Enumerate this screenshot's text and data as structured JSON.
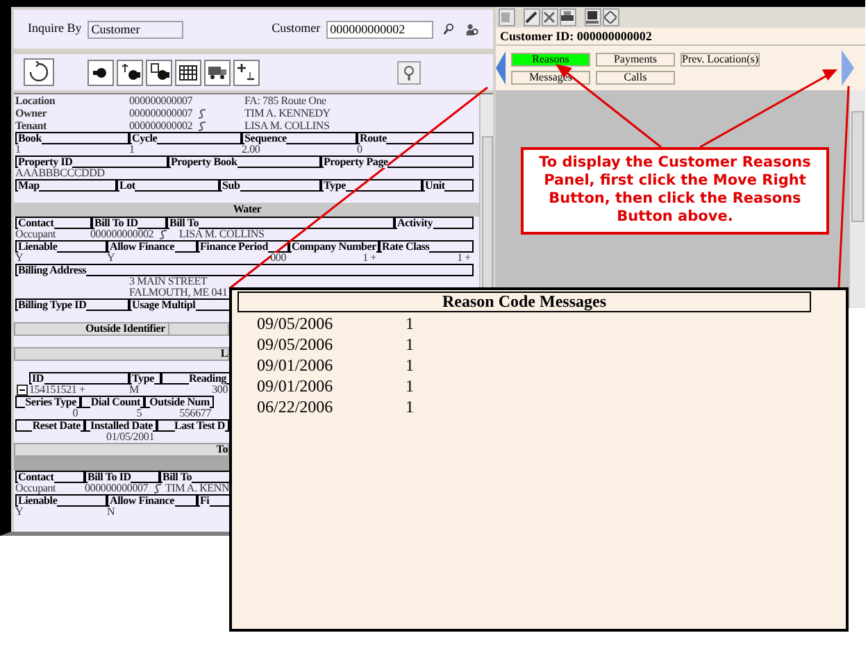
{
  "inquiry": {
    "inquire_by_label": "Inquire By",
    "inquire_by_value": "Customer",
    "customer_label": "Customer",
    "customer_value": "000000000002"
  },
  "details": [
    {
      "kind": "info",
      "cells": [
        "Location",
        "000000000007",
        "FA: 785 Route One"
      ]
    },
    {
      "kind": "info",
      "cells": [
        "Owner",
        {
          "text": "000000000007",
          "linked": true
        },
        "TIM A. KENNEDY"
      ]
    },
    {
      "kind": "info",
      "cells": [
        "Tenant",
        {
          "text": "000000000002",
          "linked": true
        },
        "LISA M. COLLINS"
      ]
    },
    {
      "kind": "header",
      "cells": [
        "Book",
        "Cycle",
        "Sequence",
        "Route"
      ]
    },
    {
      "kind": "values",
      "cells": [
        "1",
        "1",
        "2.00",
        "0"
      ]
    },
    {
      "kind": "header",
      "cells": [
        "Property ID",
        "Property Book",
        "Property Page"
      ]
    },
    {
      "kind": "values",
      "cells": [
        "AAABBBCCCDDD"
      ]
    },
    {
      "kind": "header",
      "cells": [
        "Map",
        "Lot",
        "Sub",
        "Type",
        "Unit"
      ]
    },
    {
      "kind": "blank"
    },
    {
      "kind": "section",
      "cells": [
        "Water"
      ]
    },
    {
      "kind": "header",
      "cells": [
        "Contact",
        "Bill To ID",
        "Bill To",
        "Activity"
      ]
    },
    {
      "kind": "values",
      "cells": [
        "Occupant",
        {
          "text": "000000000002",
          "linked": true
        },
        "LISA M. COLLINS"
      ]
    },
    {
      "kind": "header",
      "cells": [
        "Lienable",
        "Allow Finance",
        "Finance Period",
        "Company Number",
        "Rate Class"
      ]
    },
    {
      "kind": "values",
      "cells": [
        "Y",
        "Y",
        "000",
        "1 +",
        "1 +"
      ]
    },
    {
      "kind": "header",
      "cells": [
        "Billing Address"
      ]
    },
    {
      "kind": "values",
      "cells": [
        "",
        "3 MAIN STREET"
      ]
    },
    {
      "kind": "values",
      "cells": [
        "",
        "FALMOUTH, ME 041"
      ]
    },
    {
      "kind": "header",
      "cells": [
        "Billing Type ID",
        "Usage Multipl"
      ]
    },
    {
      "kind": "blank"
    },
    {
      "kind": "band",
      "cells": [
        "Outside Identifier",
        ""
      ]
    },
    {
      "kind": "blank"
    },
    {
      "kind": "band",
      "cells": [
        "L"
      ]
    },
    {
      "kind": "blank"
    },
    {
      "kind": "header",
      "cells": [
        "ID",
        "Type",
        "Reading"
      ]
    },
    {
      "kind": "values",
      "cells": [
        "154151521 +",
        "M",
        "300"
      ]
    },
    {
      "kind": "header",
      "cells": [
        "Series Type",
        "Dial Count",
        "Outside Num"
      ]
    },
    {
      "kind": "values",
      "cells": [
        "0",
        "5",
        "556677"
      ]
    },
    {
      "kind": "header",
      "cells": [
        "Reset Date",
        "Installed Date",
        "Last Test D"
      ]
    },
    {
      "kind": "values",
      "cells": [
        "",
        "01/05/2001"
      ]
    },
    {
      "kind": "band",
      "cells": [
        "To"
      ]
    },
    {
      "kind": "dark"
    },
    {
      "kind": "header",
      "cells": [
        "Contact",
        "Bill To ID",
        "Bill To"
      ]
    },
    {
      "kind": "values",
      "cells": [
        "Occupant",
        {
          "text": "000000000007",
          "linked": true
        },
        "TIM A. KENN"
      ]
    },
    {
      "kind": "header",
      "cells": [
        "Lienable",
        "Allow Finance",
        "Fi"
      ]
    },
    {
      "kind": "values",
      "cells": [
        "Y",
        "N"
      ]
    }
  ],
  "right_panel": {
    "customer_id": "Customer ID: 000000000002",
    "buttons": [
      {
        "label": "Reasons",
        "selected": true
      },
      {
        "label": "Payments",
        "selected": false
      },
      {
        "label": "Prev. Location(s)",
        "selected": false
      },
      {
        "label": "Messages",
        "selected": false
      },
      {
        "label": "Calls",
        "selected": false
      }
    ]
  },
  "callout": "To display the Customer Reasons Panel, first click the Move Right Button, then click the Reasons Button above.",
  "reason_popup": {
    "title": "Reason Code Messages",
    "rows": [
      {
        "date": "09/05/2006",
        "code": "1"
      },
      {
        "date": "09/05/2006",
        "code": "1"
      },
      {
        "date": "09/01/2006",
        "code": "1"
      },
      {
        "date": "09/01/2006",
        "code": "1"
      },
      {
        "date": "06/22/2006",
        "code": "1"
      }
    ]
  }
}
